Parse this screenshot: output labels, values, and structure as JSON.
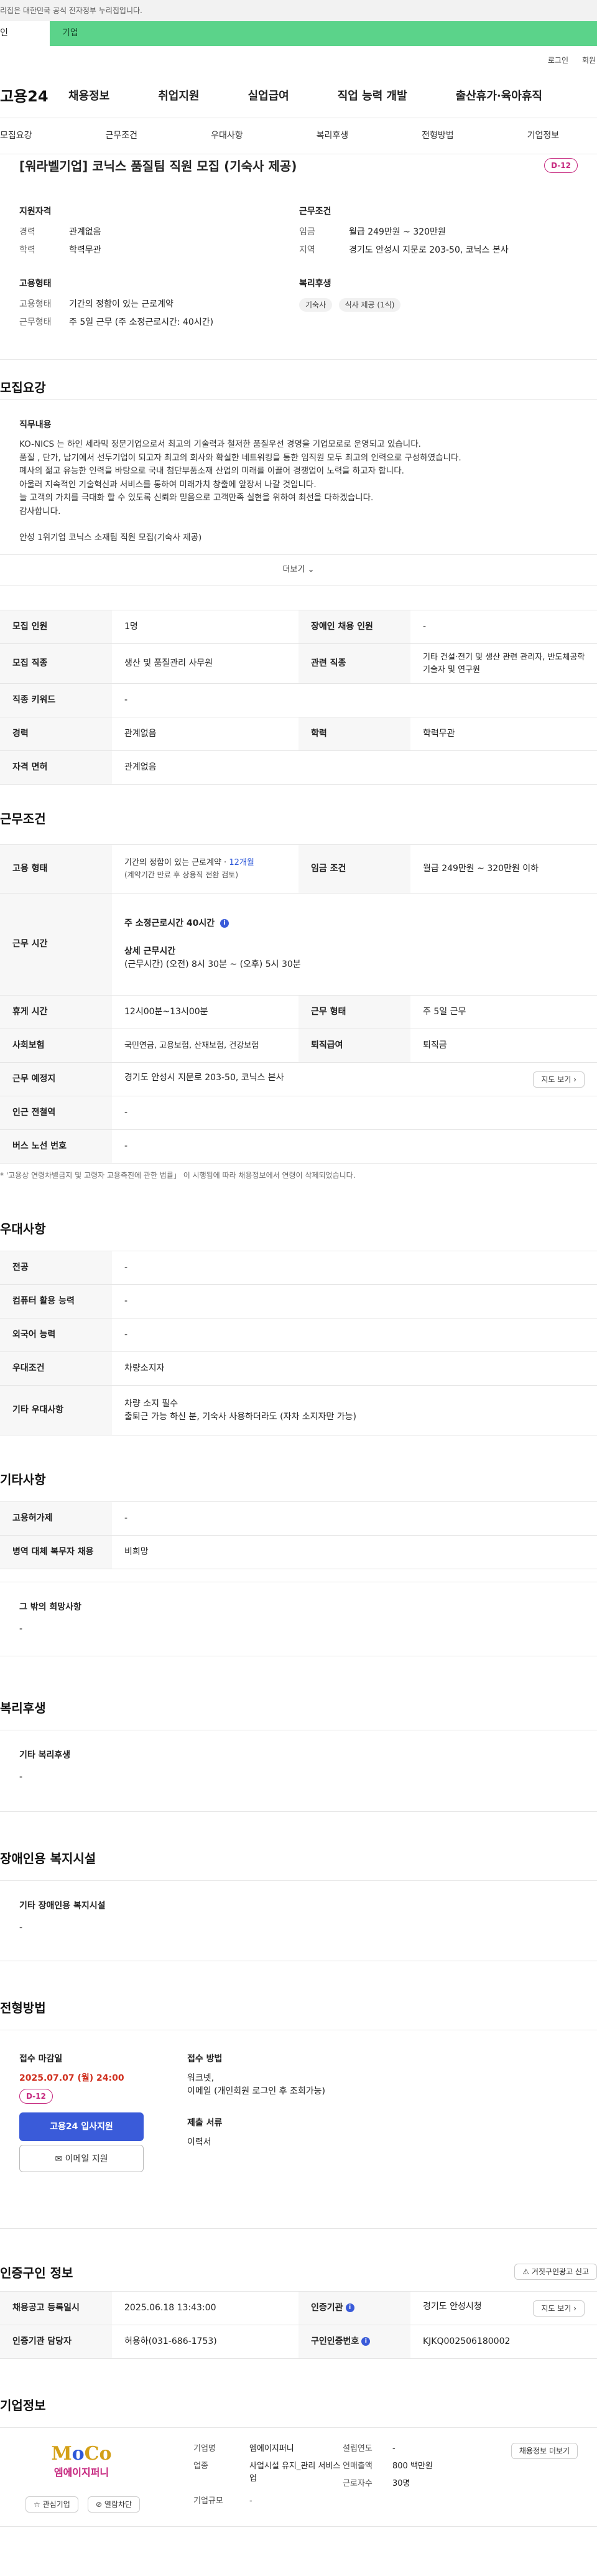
{
  "gov_banner": "리집은 대한민국 공식 전자정부 누리집입니다.",
  "top_tabs": {
    "personal": "인",
    "corporate": "기업"
  },
  "util_links": [
    "로그인",
    "회원"
  ],
  "header": {
    "logo": "고용24",
    "nav": [
      "채용정보",
      "취업지원",
      "실업급여",
      "직업 능력 개발",
      "출산휴가·육아휴직"
    ]
  },
  "subnav": [
    "모집요강",
    "근무조건",
    "우대사항",
    "복리후생",
    "전형방법",
    "기업정보"
  ],
  "summary": {
    "title": "[워라벨기업] 코닉스 품질팀 직원 모집 (기숙사 제공)",
    "dday": "D-12",
    "qualification": {
      "heading": "지원자격",
      "rows": [
        {
          "k": "경력",
          "v": "관계없음"
        },
        {
          "k": "학력",
          "v": "학력무관"
        }
      ]
    },
    "conditions": {
      "heading": "근무조건",
      "rows": [
        {
          "k": "임금",
          "v": "월급 249만원 ~ 320만원"
        },
        {
          "k": "지역",
          "v": "경기도 안성시 지문로 203-50, 코닉스 본사"
        }
      ]
    },
    "employment": {
      "heading": "고용형태",
      "rows": [
        {
          "k": "고용형태",
          "v": "기간의 정함이 있는 근로계약"
        },
        {
          "k": "근무형태",
          "v": "주 5일 근무 (주 소정근로시간: 40시간)"
        }
      ]
    },
    "welfare": {
      "heading": "복리후생",
      "chips": [
        "기숙사",
        "식사 제공 (1식)"
      ]
    }
  },
  "recruit": {
    "heading": "모집요강",
    "label": "직무내용",
    "lines": [
      "KO-NICS 는 하인 세라믹 정문기업으로서 최고의 기술력과 철저한 품질우선 경영을 기업모로로 운영되고 있습니다.",
      "품질 , 단가, 납기에서 선두기업이 되고자 최고의 회사와 확실한 네트워킹을 통한 임직원 모두 최고의 인력으로 구성하였습니다.",
      "폐사의 젊고 유능한 인력을 바탕으로 국내 첨단부품소재 산업의 미래를 이끌어 경쟁업이 노력을 하고자 합니다.",
      "아울러 지속적인 기술혁신과 서비스를 통하여 미래가치 창출에 앞장서 나갈 것입니다.",
      "늘 고객의 가치를 극대화 할 수 있도록 신뢰와 믿음으로 고객만족 실현을 위하여 최선을 다하겠습니다.",
      "감사합니다.",
      "",
      "안성 1위기업 코닉스  소재팀 직원 모집(기숙사 제공)"
    ],
    "more": "더보기"
  },
  "recruit_table": [
    [
      {
        "k": "모집 인원",
        "v": "1명"
      },
      {
        "k": "장애인 채용 인원",
        "v": "-"
      }
    ],
    [
      {
        "k": "모집 직종",
        "v": "생산 및 품질관리 사무원"
      },
      {
        "k": "관련 직종",
        "v": "기타 건설·전기 및 생산 관련 관리자, 반도체공학 기술자 및 연구원"
      }
    ],
    [
      {
        "k": "직종 키워드",
        "v": "-"
      }
    ],
    [
      {
        "k": "경력",
        "v": "관계없음"
      },
      {
        "k": "학력",
        "v": "학력무관"
      }
    ],
    [
      {
        "k": "자격 면허",
        "v": "관계없음"
      }
    ]
  ],
  "work": {
    "heading": "근무조건",
    "employment_type_k": "고용 형태",
    "employment_type_v1": "기간의 정함이 있는 근로계약 · ",
    "employment_type_months": "12개월",
    "employment_type_v2": "(계약기간 만료 후 상용직 전환 검토)",
    "wage_k": "임금 조건",
    "wage_v": "월급 249만원 ~ 320만원 이하",
    "hours_k": "근무 시간",
    "hours_weekly": "주 소정근로시간  40시간",
    "hours_detail_label": "상세 근무시간",
    "hours_detail": "(근무시간) (오전) 8시 30분 ~ (오후) 5시 30분",
    "rows": [
      [
        {
          "k": "휴게 시간",
          "v": "12시00분~13시00분"
        },
        {
          "k": "근무 형태",
          "v": "주 5일 근무"
        }
      ],
      [
        {
          "k": "사회보험",
          "v": "국민연금, 고용보험, 산재보험, 건강보험"
        },
        {
          "k": "퇴직급여",
          "v": "퇴직금"
        }
      ]
    ],
    "place_k": "근무 예정지",
    "place_v": "경기도 안성시 지문로 203-50, 코닉스 본사",
    "map_btn": "지도 보기",
    "station_k": "인근 전철역",
    "station_v": "-",
    "bus_k": "버스 노선 번호",
    "bus_v": "-",
    "note": "* '고용상 연령차별금지 및 고령자 고용촉진에 관한 법률」 이 시행됨에 따라 채용정보에서 연령이 삭제되었습니다."
  },
  "pref": {
    "heading": "우대사항",
    "rows": [
      {
        "k": "전공",
        "v": "-"
      },
      {
        "k": "컴퓨터 활용 능력",
        "v": "-"
      },
      {
        "k": "외국어 능력",
        "v": "-"
      },
      {
        "k": "우대조건",
        "v": "차량소지자"
      },
      {
        "k": "기타 우대사항",
        "v": "차량 소지 필수",
        "v2": "출퇴근 가능 하신 분,  기숙사 사용하더라도 (자차 소지자만 가능)"
      }
    ]
  },
  "etc": {
    "heading": "기타사항",
    "rows": [
      {
        "k": "고용허가제",
        "v": "-"
      },
      {
        "k": "병역 대체 복무자 채용",
        "v": "비희망"
      }
    ],
    "hope_label": "그 밖의 희망사항",
    "hope_value": "-"
  },
  "welfare_sec": {
    "heading": "복리후생",
    "label": "기타 복리후생",
    "value": "-"
  },
  "disabled_sec": {
    "heading": "장애인용 복지시설",
    "label": "기타 장애인용 복지시설",
    "value": "-"
  },
  "process": {
    "heading": "전형방법",
    "deadline_label": "접수 마감일",
    "deadline": "2025.07.07 (월) 24:00",
    "dday": "D-12",
    "apply_btn": "고용24 입사지원",
    "email_btn": "이메일 지원",
    "method_label": "접수 방법",
    "method_v1": "워크넷,",
    "method_v2": "이메일 (개인회원 로그인 후 조회가능)",
    "docs_label": "제출 서류",
    "docs_v": "이력서"
  },
  "cert": {
    "heading": "인증구인 정보",
    "report_btn": "거짓구인광고 신고",
    "rows": [
      [
        {
          "k": "채용공고 등록일시",
          "v": "2025.06.18 13:43:00"
        },
        {
          "k": "인증기관",
          "v": "경기도 안성시청"
        }
      ],
      [
        {
          "k": "인증기관 담당자",
          "v": "허용하(031-686-1753)"
        },
        {
          "k": "구인인증번호",
          "v": "KJKQ002506180002"
        }
      ]
    ],
    "map_btn": "지도 보기"
  },
  "company": {
    "heading": "기업정보",
    "logo_text": "엠에이지퍼니",
    "fav_btn": "관심기업",
    "block_btn": "열람차단",
    "more_btn": "채용정보 더보기",
    "col1": [
      {
        "k": "기업명",
        "v": "엠에이지퍼니"
      },
      {
        "k": "업종",
        "v": "사업시설 유지_관리 서비스업"
      },
      {
        "k": "기업규모",
        "v": "-"
      }
    ],
    "col2": [
      {
        "k": "설립연도",
        "v": "-"
      },
      {
        "k": "연매출액",
        "v": "800 백만원"
      },
      {
        "k": "근로자수",
        "v": "30명"
      }
    ]
  },
  "colors": {
    "accent": "#3a5bd9",
    "dday": "#c6287f",
    "deadline": "#d0301f",
    "corp_tab": "#5bd38a"
  }
}
